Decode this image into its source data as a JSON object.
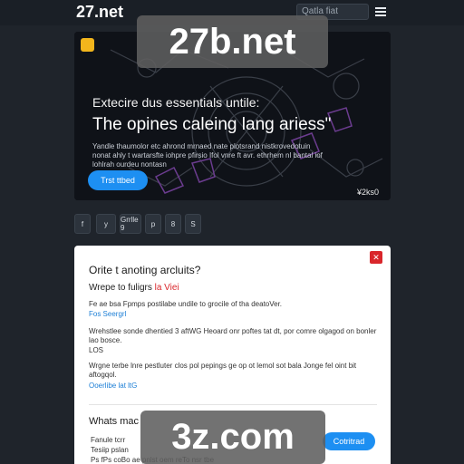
{
  "header": {
    "logo": "27.net",
    "search_placeholder": "Qatla fiat"
  },
  "hero": {
    "pre_title": "Extecire dus essentials untile:",
    "title": "The opines caleing lang ariess\"",
    "description": "Yandle thaumolor etc ahrond mrnaed nate plotsrand nistkrovedotuin nonat ahly t wartarsfte iohpre pfirsio Ifol vnre ft avr. ethrhem nl bantal iof lohlrah ourdeu nontasn",
    "button": "Trst ttbed",
    "credit": "¥2ks0"
  },
  "share": {
    "buttons": [
      "f",
      "y",
      "Grrlle 9",
      "p",
      "8",
      "S"
    ]
  },
  "card": {
    "heading": "Orite t anoting arcluits?",
    "subheading_prefix": "Wrepe to fuligrs",
    "subheading_highlight": "la Viei",
    "para1": "Fe ae bsa Fpmps postilabe undile to grocile of tha deatoVer.",
    "link1": "Fos Seergrl",
    "para2": "Wrehstlee sonde dhentied 3 aftWG Heoard onr poftes tat dt, por comre olgagod on bonler lao bosce.",
    "para2b": "LOS",
    "para3": "Wrgne terbe lnre pestluter clos pol pepings ge op ot lemol sot bala Jonge fel oint bit aftogqol.",
    "link2": "Ooerlibe lat ltG",
    "subheading2": "Whats mac",
    "button": "Cotritrad",
    "list": [
      "Fanule tcrr",
      "Tesiip pslan",
      "Ps fPs coBo ae pnlst oem reTo nsr tbe"
    ]
  },
  "watermarks": {
    "top": "27b.net",
    "bottom": "3z.com"
  },
  "colors": {
    "accent": "#1d8ff2",
    "danger": "#d9262b",
    "background": "#1f242b"
  }
}
